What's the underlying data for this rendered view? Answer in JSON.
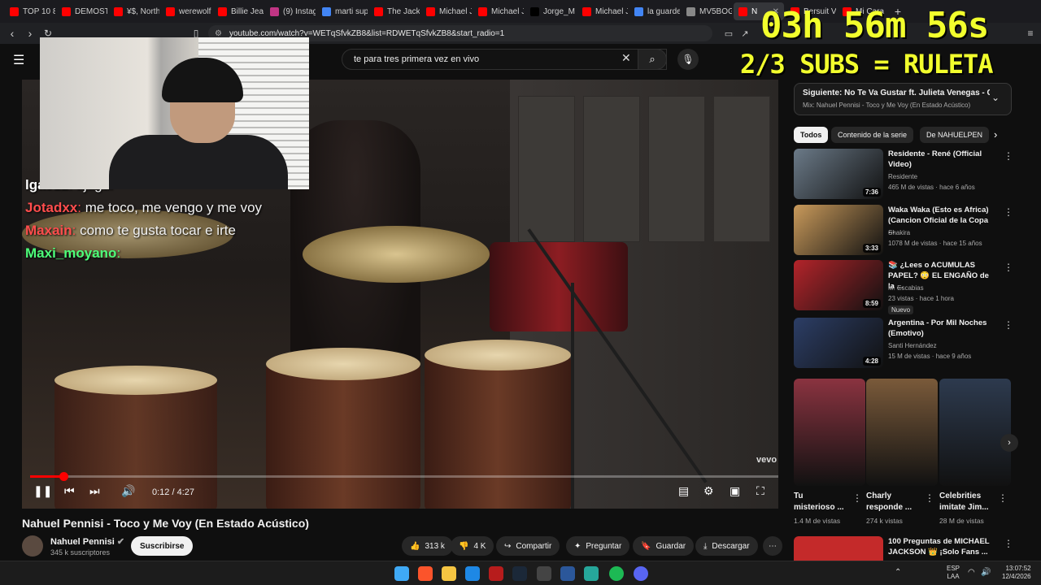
{
  "browser": {
    "tabs": [
      {
        "label": "TOP 10 8",
        "color": "#ff0000"
      },
      {
        "label": "DEMOST",
        "color": "#ff0000"
      },
      {
        "label": "¥$, North",
        "color": "#ff0000"
      },
      {
        "label": "werewolf",
        "color": "#ff0000"
      },
      {
        "label": "Billie Jea",
        "color": "#ff0000"
      },
      {
        "label": "(9) Instag",
        "color": "#c13584"
      },
      {
        "label": "marti sup",
        "color": "#4285f4"
      },
      {
        "label": "The Jacks",
        "color": "#ff0000"
      },
      {
        "label": "Michael J",
        "color": "#ff0000"
      },
      {
        "label": "Michael J",
        "color": "#ff0000"
      },
      {
        "label": "Jorge_M",
        "color": "#000000"
      },
      {
        "label": "Michael J",
        "color": "#ff0000"
      },
      {
        "label": "la guarde",
        "color": "#4285f4"
      },
      {
        "label": "MV5BOG",
        "color": "#888888"
      },
      {
        "label": "N",
        "color": "#ff0000",
        "active": true
      },
      {
        "label": "Bersuit V",
        "color": "#ff0000"
      },
      {
        "label": "Mi Cara",
        "color": "#ff0000"
      }
    ],
    "new_tab": "+",
    "url": "youtube.com/watch?v=WETqSfvkZB8&list=RDWETqSfvkZB8&start_radio=1"
  },
  "youtube": {
    "search_value": "te para tres primera vez en vivo"
  },
  "overlay": {
    "timer": "03h 56m 56s",
    "subs": "2/3 SUBS = RULETA"
  },
  "chat": [
    {
      "user": "lga912",
      "text": "ajugar",
      "color": "#ffffff"
    },
    {
      "user": "Jotadxx",
      "text": "me toco, me vengo y me voy",
      "color": "#ff4d4d"
    },
    {
      "user": "Maxain",
      "text": "como te gusta tocar e irte",
      "color": "#ff4d4d"
    },
    {
      "user": "Maxi_moyano",
      "text": "",
      "color": "#4dff7a"
    }
  ],
  "player": {
    "watermark": "vevo",
    "time": "0:12 / 4:27",
    "progress": 0.045
  },
  "video": {
    "title": "Nahuel Pennisi - Toco y Me Voy (En Estado Acústico)",
    "channel": "Nahuel Pennisi",
    "subscribers": "345 k suscriptores",
    "subscribe": "Suscribirse",
    "likes": "313 k",
    "dislikes": "4 K",
    "share": "Compartir",
    "ask": "Preguntar",
    "save": "Guardar",
    "download": "Descargar"
  },
  "sidebar": {
    "next_title": "Siguiente: No Te Va Gustar ft. Julieta Venegas - Ch...",
    "next_sub": "Mix: Nahuel Pennisi - Toco y Me Voy (En Estado Acústico)",
    "chips": [
      "Todos",
      "Contenido de la serie",
      "De NAHUELPEN"
    ],
    "recommendations": [
      {
        "title": "Residente - René (Official Video)",
        "channel": "Residente",
        "meta": "465 M de vistas · hace 6 años",
        "duration": "7:36",
        "thumb": "#6b7a88"
      },
      {
        "title": "Waka Waka (Esto es Africa) (Cancion Oficial de la Copa ...",
        "channel": "Shakira",
        "meta": "1078 M de vistas · hace 15 años",
        "duration": "3:33",
        "thumb": "#c99a5b"
      },
      {
        "title": "📚 ¿Lees o ACUMULAS PAPEL? 😳 EL ENGAÑO de la ...",
        "channel": "M. Escabias",
        "meta": "23 vistas · hace 1 hora",
        "duration": "8:59",
        "thumb": "#b3242a",
        "badge": "Nuevo"
      },
      {
        "title": "Argentina - Por Mil Noches (Emotivo)",
        "channel": "Santi Hernández",
        "meta": "15 M de vistas · hace 9 años",
        "duration": "4:28",
        "thumb": "#2c3e66"
      }
    ],
    "shorts": [
      {
        "title": "Tu misterioso ...",
        "views": "1.4 M de vistas",
        "thumb": "#8a3340"
      },
      {
        "title": "Charly responde ...",
        "views": "274 k vistas",
        "thumb": "#7a5a3a"
      },
      {
        "title": "Celebrities imitate Jim...",
        "views": "28 M de vistas",
        "thumb": "#2d3a4e"
      }
    ],
    "bottom_title": "100 Preguntas de MICHAEL JACKSON 👑 ¡Solo Fans ..."
  },
  "taskbar": {
    "lang": "ESP",
    "lang2": "LAA",
    "clock": "13:07:52",
    "date": "12/4/2026"
  }
}
